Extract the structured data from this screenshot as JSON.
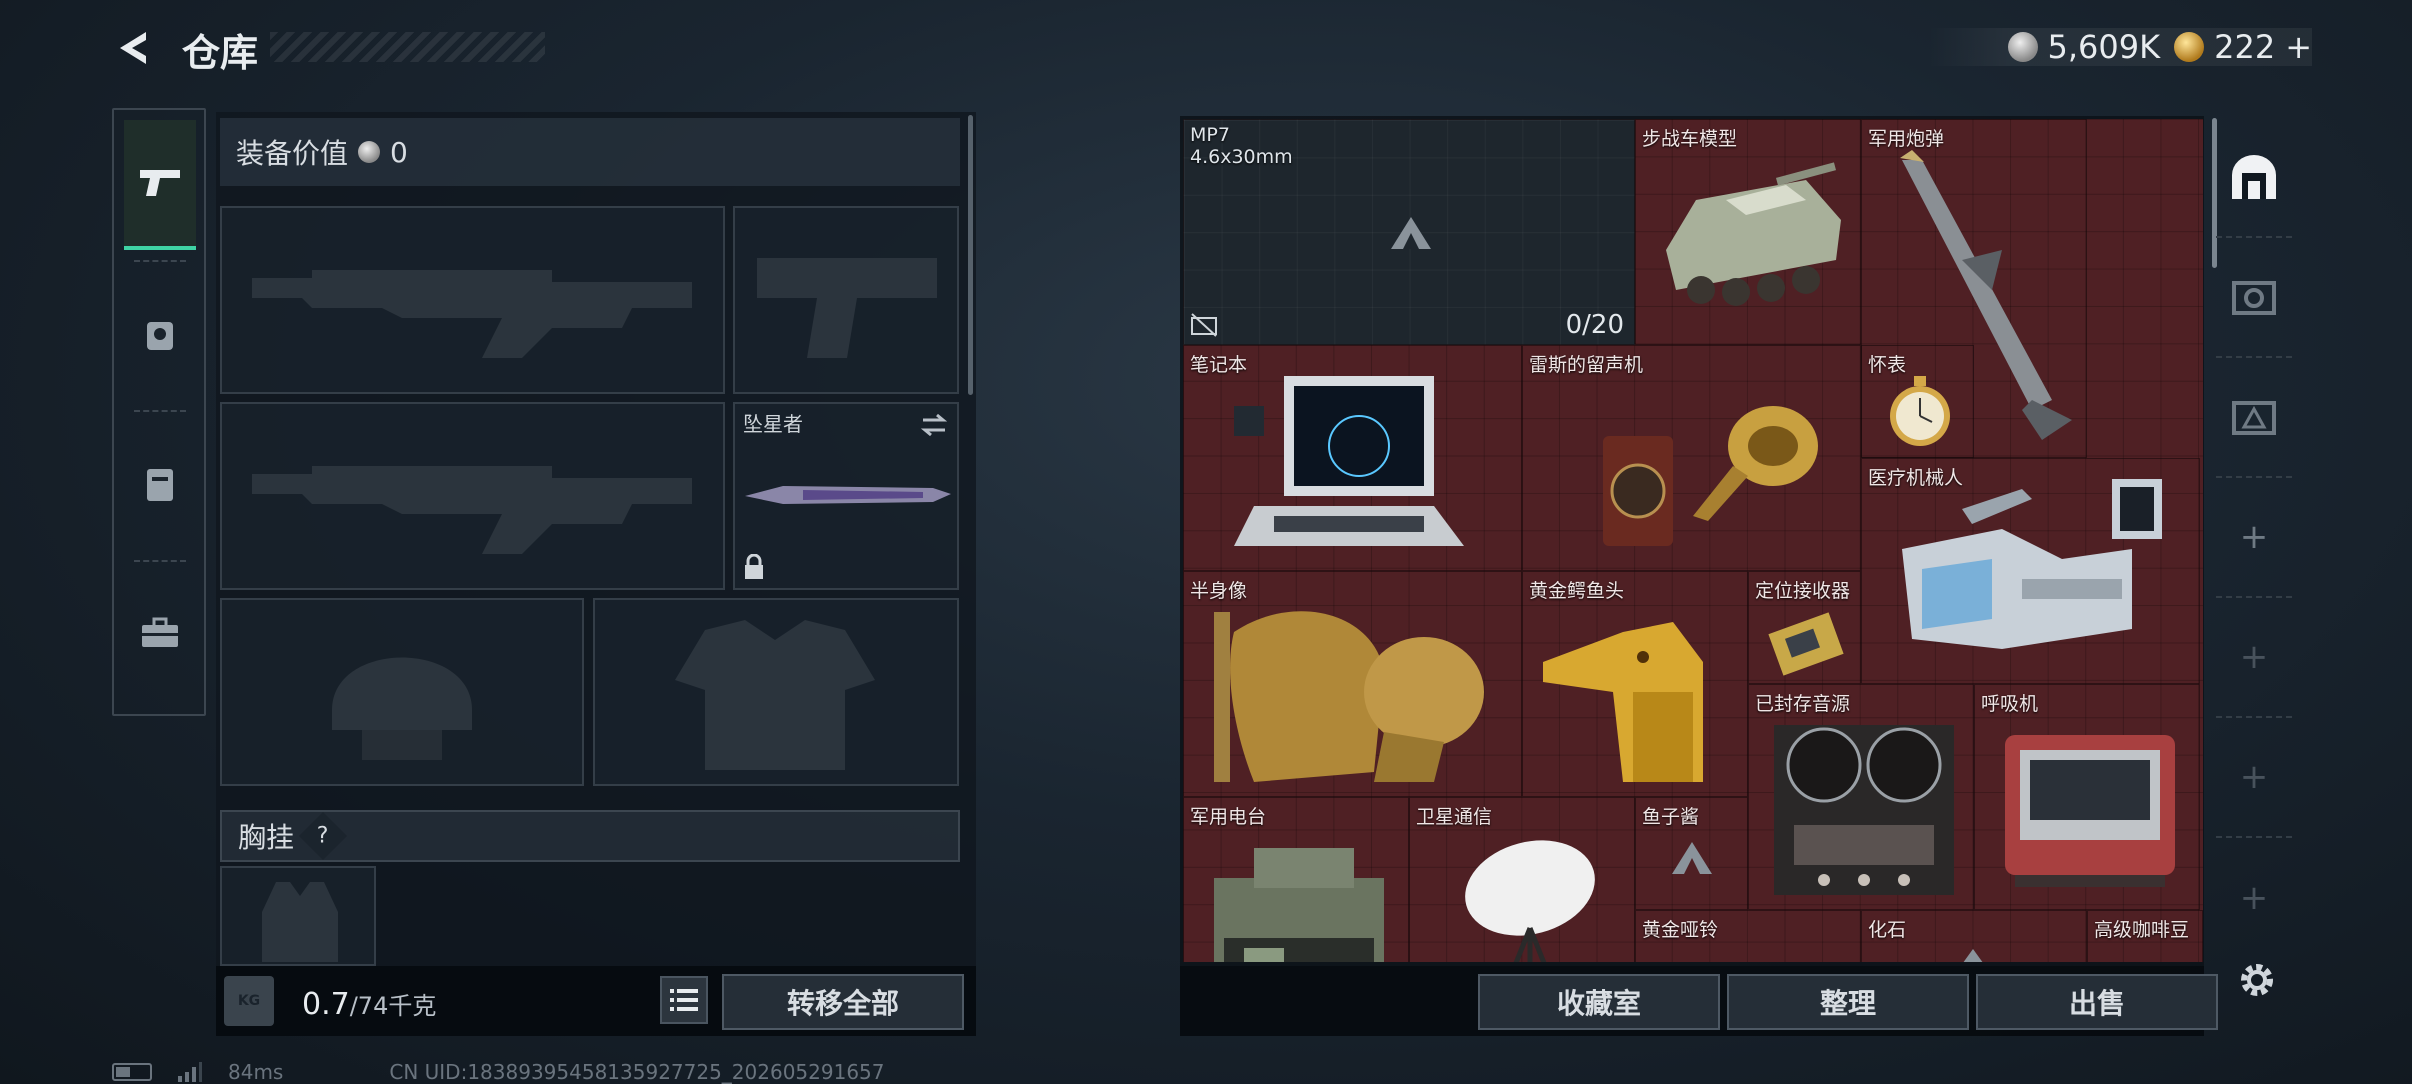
{
  "header": {
    "title": "仓库",
    "currency": [
      {
        "icon": "silver-coin-icon",
        "value": "5,609K"
      },
      {
        "icon": "gold-coin-icon",
        "value": "222",
        "add": "+"
      }
    ]
  },
  "categories": [
    {
      "icon": "pistol-icon",
      "active": true
    },
    {
      "icon": "backpack-helmet-icon",
      "active": false
    },
    {
      "icon": "backpack-icon",
      "active": false
    },
    {
      "icon": "toolbox-icon",
      "active": false
    }
  ],
  "equipment": {
    "value_label": "装备价值",
    "value": "0",
    "melee_slot_label": "坠星者",
    "chest_label": "胸挂",
    "chest_help": "?",
    "weight_icon": "KG",
    "weight": "0.7",
    "weight_max": "/74千克",
    "transfer_all": "转移全部"
  },
  "storage": {
    "mp7": {
      "name": "MP7",
      "ammo_type": "4.6x30mm",
      "ammo": "0/20"
    },
    "items": [
      "步战车模型",
      "军用炮弹",
      "笔记本",
      "雷斯的留声机",
      "怀表",
      "医疗机械人",
      "半身像",
      "黄金鳄鱼头",
      "定位接收器",
      "已封存音源",
      "呼吸机",
      "军用电台",
      "卫星通信",
      "鱼子酱",
      "黄金哑铃",
      "化石",
      "高级咖啡豆"
    ]
  },
  "buttons": {
    "collection": "收藏室",
    "organize": "整理",
    "sell": "出售"
  },
  "status": {
    "ping": "84ms",
    "uid": "CN UID:18389395458135927725_202605291657"
  },
  "colors": {
    "accent": "#3fd3a4",
    "grid_bg": "#4f2024"
  }
}
